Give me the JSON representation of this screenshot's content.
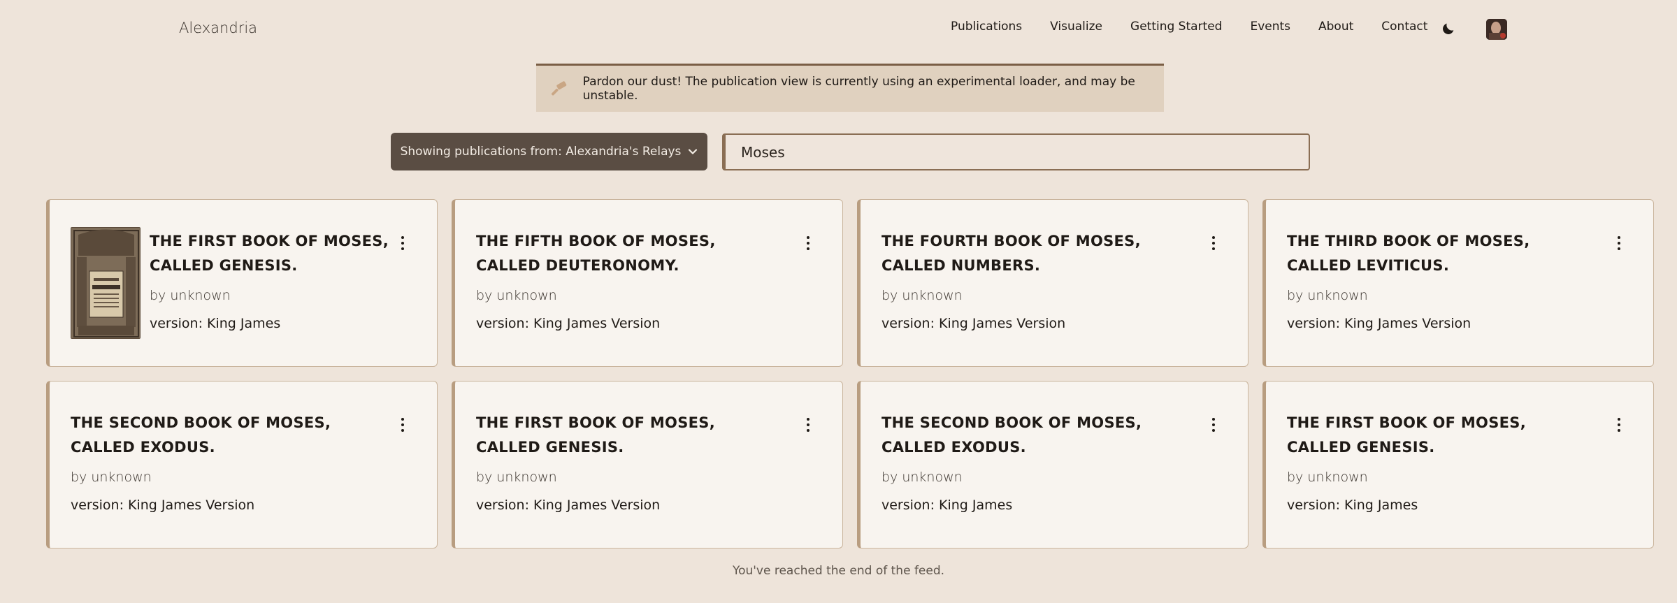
{
  "header": {
    "brand": "Alexandria",
    "nav": [
      "Publications",
      "Visualize",
      "Getting Started",
      "Events",
      "About",
      "Contact"
    ]
  },
  "banner": {
    "icon": "hammer-icon",
    "message": "Pardon our dust! The publication view is currently using an experimental loader, and may be unstable."
  },
  "filter": {
    "relay_label": "Showing publications from: Alexandria's Relays",
    "search_value": "Moses"
  },
  "cards": [
    {
      "title": "THE FIRST BOOK OF MOSES, CALLED GENESIS.",
      "author": "by unknown",
      "version": "version: King James",
      "has_cover": true
    },
    {
      "title": "THE FIFTH BOOK OF MOSES, CALLED DEUTERONOMY.",
      "author": "by unknown",
      "version": "version: King James Version",
      "has_cover": false
    },
    {
      "title": "THE FOURTH BOOK OF MOSES, CALLED NUMBERS.",
      "author": "by unknown",
      "version": "version: King James Version",
      "has_cover": false
    },
    {
      "title": "THE THIRD BOOK OF MOSES, CALLED LEVITICUS.",
      "author": "by unknown",
      "version": "version: King James Version",
      "has_cover": false
    },
    {
      "title": "THE SECOND BOOK OF MOSES, CALLED EXODUS.",
      "author": "by unknown",
      "version": "version: King James Version",
      "has_cover": false
    },
    {
      "title": "THE FIRST BOOK OF MOSES, CALLED GENESIS.",
      "author": "by unknown",
      "version": "version: King James Version",
      "has_cover": false
    },
    {
      "title": "THE SECOND BOOK OF MOSES, CALLED EXODUS.",
      "author": "by unknown",
      "version": "version: King James",
      "has_cover": false
    },
    {
      "title": "THE FIRST BOOK OF MOSES, CALLED GENESIS.",
      "author": "by unknown",
      "version": "version: King James",
      "has_cover": false
    }
  ],
  "end_message": "You've reached the end of the feed."
}
